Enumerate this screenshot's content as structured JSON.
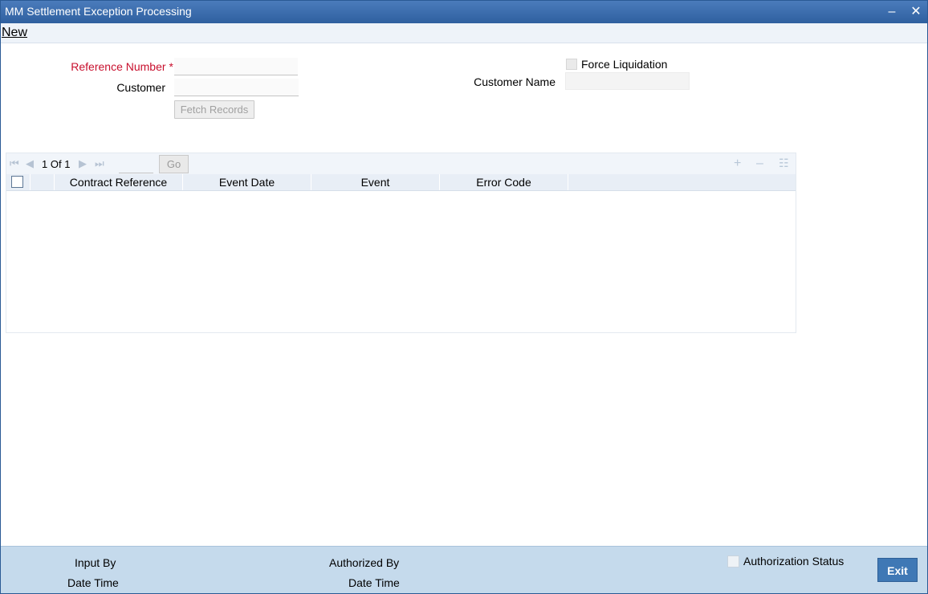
{
  "window": {
    "title": "MM Settlement Exception Processing",
    "minimize_glyph": "–",
    "close_glyph": "✕"
  },
  "menu": {
    "new_label": "New"
  },
  "form": {
    "reference_number_label": "Reference Number",
    "required_marker": "*",
    "reference_number_value": "",
    "customer_label": "Customer",
    "customer_value": "",
    "fetch_records_label": "Fetch Records",
    "force_liquidation_label": "Force Liquidation",
    "force_liquidation_checked": false,
    "customer_name_label": "Customer Name",
    "customer_name_value": ""
  },
  "grid": {
    "pager": {
      "current_page": "1",
      "of_label": "Of",
      "total_pages": "1",
      "go_label": "Go",
      "page_input_value": ""
    },
    "toolbar_icons": [
      "first-page-icon",
      "previous-page-icon",
      "next-page-icon",
      "last-page-icon",
      "add-row-icon",
      "delete-row-icon",
      "columns-icon"
    ],
    "columns": [
      "Contract Reference",
      "Event Date",
      "Event",
      "Error Code"
    ],
    "rows": []
  },
  "footer": {
    "input_by_label": "Input By",
    "date_time_label_1": "Date Time",
    "authorized_by_label": "Authorized By",
    "date_time_label_2": "Date Time",
    "authorization_status_label": "Authorization Status",
    "exit_label": "Exit"
  },
  "colors": {
    "title_bar": "#2f609f",
    "required_label": "#c8102e",
    "footer_bg": "#c5daec",
    "exit_button": "#3f78b5",
    "grid_header": "#e8eef6"
  }
}
